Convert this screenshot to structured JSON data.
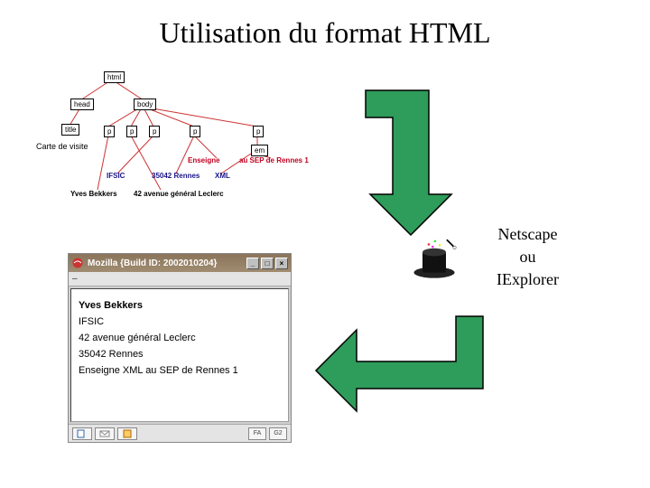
{
  "title": "Utilisation du format HTML",
  "tree": {
    "caption": "Carte de visite",
    "nodes": {
      "html": "html",
      "head": "head",
      "body": "body",
      "title": "title",
      "p1": "p",
      "p2": "p",
      "p3": "p",
      "p4": "p",
      "p5": "p",
      "em": "em"
    },
    "leaves": {
      "enseigne": "Enseigne",
      "sep": "au SEP de Rennes 1",
      "ifsic": "IFSIC",
      "rennes": "35042 Rennes",
      "xml": "XML",
      "name": "Yves Bekkers",
      "addr": "42 avenue général Leclerc"
    }
  },
  "browsers": {
    "a": "Netscape",
    "ou": "ou",
    "b": "IExplorer"
  },
  "window": {
    "title": "Mozilla {Build ID: 2002010204}",
    "menu": {
      "a": "–",
      "b": " ",
      "c": " "
    },
    "content": {
      "l1": "Yves Bekkers",
      "l2": "IFSIC",
      "l3": "42 avenue général Leclerc",
      "l4": "35042 Rennes",
      "l5": "Enseigne XML au SEP de Rennes 1"
    },
    "status": {
      "a": "",
      "b": "FA",
      "c": "G2"
    }
  },
  "colors": {
    "arrow_fill": "#2e9c5a",
    "arrow_stroke": "#000",
    "red_leaf": "#c00020",
    "blue_leaf": "#1a148a"
  }
}
